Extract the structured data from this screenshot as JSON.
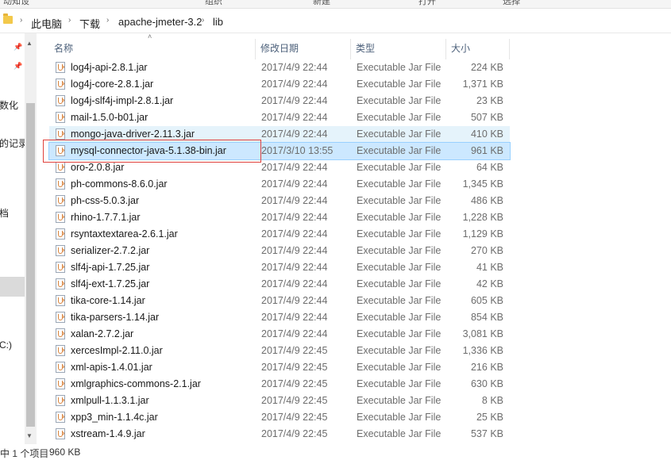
{
  "ribbon": {
    "labels": [
      "动知设",
      "组织",
      "新建",
      "打开",
      "选择"
    ]
  },
  "address": {
    "crumbs": [
      "此电脑",
      "下载",
      "apache-jmeter-3.2",
      "lib"
    ]
  },
  "nav": {
    "fragments": [
      "数化",
      "的记录",
      "档",
      "C:)"
    ]
  },
  "columns": {
    "name": "名称",
    "date": "修改日期",
    "type": "类型",
    "size": "大小"
  },
  "files": [
    {
      "name": "log4j-api-2.8.1.jar",
      "date": "2017/4/9 22:44",
      "type": "Executable Jar File",
      "size": "224 KB"
    },
    {
      "name": "log4j-core-2.8.1.jar",
      "date": "2017/4/9 22:44",
      "type": "Executable Jar File",
      "size": "1,371 KB"
    },
    {
      "name": "log4j-slf4j-impl-2.8.1.jar",
      "date": "2017/4/9 22:44",
      "type": "Executable Jar File",
      "size": "23 KB"
    },
    {
      "name": "mail-1.5.0-b01.jar",
      "date": "2017/4/9 22:44",
      "type": "Executable Jar File",
      "size": "507 KB"
    },
    {
      "name": "mongo-java-driver-2.11.3.jar",
      "date": "2017/4/9 22:44",
      "type": "Executable Jar File",
      "size": "410 KB"
    },
    {
      "name": "mysql-connector-java-5.1.38-bin.jar",
      "date": "2017/3/10 13:55",
      "type": "Executable Jar File",
      "size": "961 KB"
    },
    {
      "name": "oro-2.0.8.jar",
      "date": "2017/4/9 22:44",
      "type": "Executable Jar File",
      "size": "64 KB"
    },
    {
      "name": "ph-commons-8.6.0.jar",
      "date": "2017/4/9 22:44",
      "type": "Executable Jar File",
      "size": "1,345 KB"
    },
    {
      "name": "ph-css-5.0.3.jar",
      "date": "2017/4/9 22:44",
      "type": "Executable Jar File",
      "size": "486 KB"
    },
    {
      "name": "rhino-1.7.7.1.jar",
      "date": "2017/4/9 22:44",
      "type": "Executable Jar File",
      "size": "1,228 KB"
    },
    {
      "name": "rsyntaxtextarea-2.6.1.jar",
      "date": "2017/4/9 22:44",
      "type": "Executable Jar File",
      "size": "1,129 KB"
    },
    {
      "name": "serializer-2.7.2.jar",
      "date": "2017/4/9 22:44",
      "type": "Executable Jar File",
      "size": "270 KB"
    },
    {
      "name": "slf4j-api-1.7.25.jar",
      "date": "2017/4/9 22:44",
      "type": "Executable Jar File",
      "size": "41 KB"
    },
    {
      "name": "slf4j-ext-1.7.25.jar",
      "date": "2017/4/9 22:44",
      "type": "Executable Jar File",
      "size": "42 KB"
    },
    {
      "name": "tika-core-1.14.jar",
      "date": "2017/4/9 22:44",
      "type": "Executable Jar File",
      "size": "605 KB"
    },
    {
      "name": "tika-parsers-1.14.jar",
      "date": "2017/4/9 22:44",
      "type": "Executable Jar File",
      "size": "854 KB"
    },
    {
      "name": "xalan-2.7.2.jar",
      "date": "2017/4/9 22:44",
      "type": "Executable Jar File",
      "size": "3,081 KB"
    },
    {
      "name": "xercesImpl-2.11.0.jar",
      "date": "2017/4/9 22:45",
      "type": "Executable Jar File",
      "size": "1,336 KB"
    },
    {
      "name": "xml-apis-1.4.01.jar",
      "date": "2017/4/9 22:45",
      "type": "Executable Jar File",
      "size": "216 KB"
    },
    {
      "name": "xmlgraphics-commons-2.1.jar",
      "date": "2017/4/9 22:45",
      "type": "Executable Jar File",
      "size": "630 KB"
    },
    {
      "name": "xmlpull-1.1.3.1.jar",
      "date": "2017/4/9 22:45",
      "type": "Executable Jar File",
      "size": "8 KB"
    },
    {
      "name": "xpp3_min-1.1.4c.jar",
      "date": "2017/4/9 22:45",
      "type": "Executable Jar File",
      "size": "25 KB"
    },
    {
      "name": "xstream-1.4.9.jar",
      "date": "2017/4/9 22:45",
      "type": "Executable Jar File",
      "size": "537 KB"
    }
  ],
  "hover_index": 4,
  "selected_index": 5,
  "status": {
    "selection": "中 1 个项目",
    "size": "960 KB"
  },
  "colors": {
    "selected_bg": "#cce8ff",
    "hover_bg": "#e5f3fb",
    "highlight_box": "#e0413c"
  }
}
